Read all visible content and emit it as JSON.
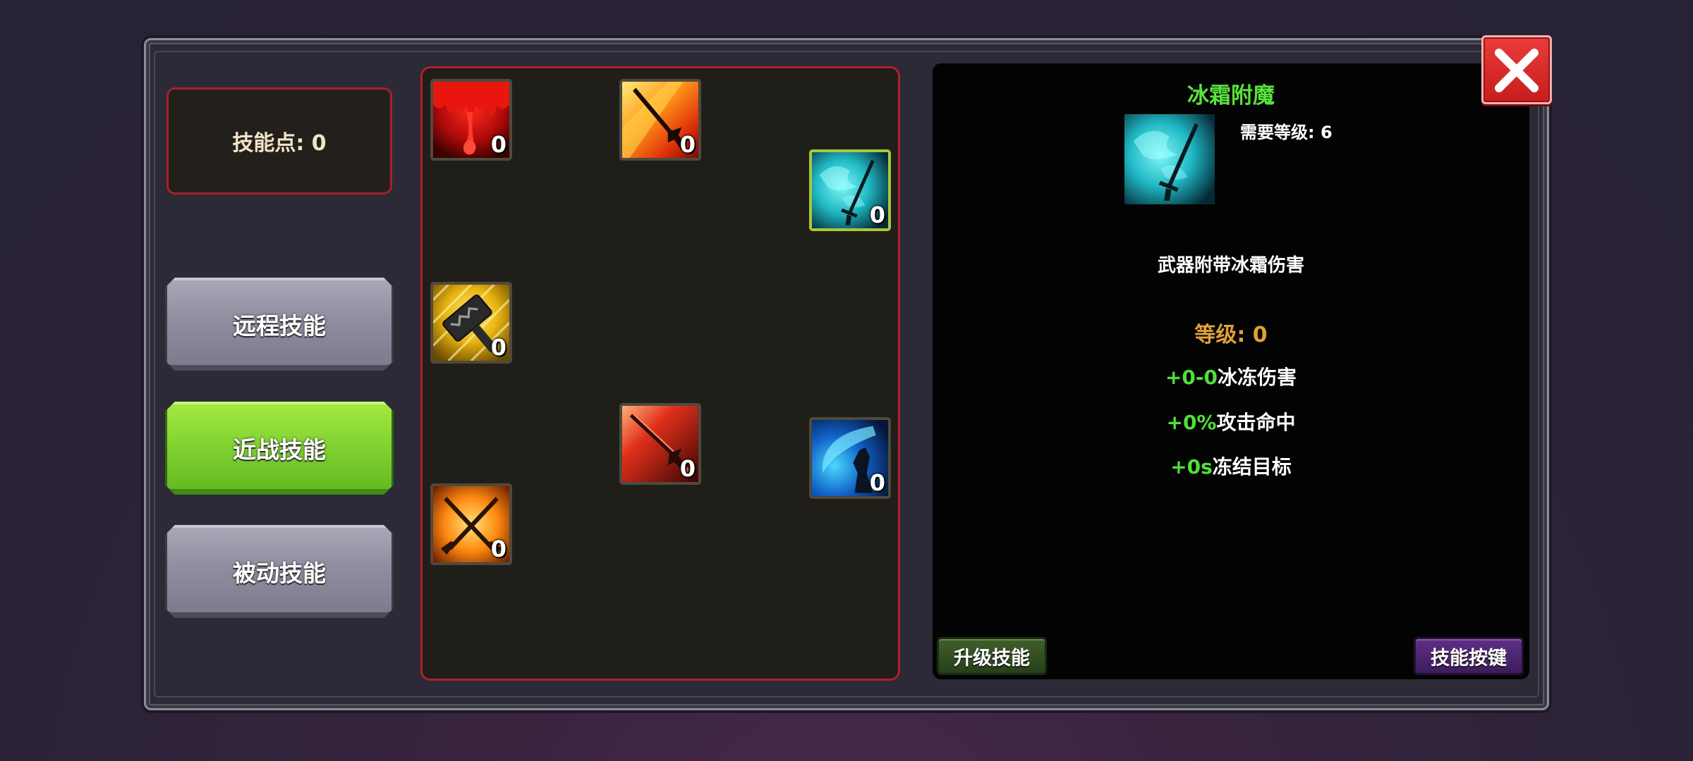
{
  "sidebar": {
    "skill_points_label": "技能点: 0",
    "categories": [
      {
        "label": "远程技能",
        "active": false
      },
      {
        "label": "近战技能",
        "active": true
      },
      {
        "label": "被动技能",
        "active": false
      }
    ]
  },
  "skill_tree": {
    "skills": [
      {
        "icon": "blood-drip-icon",
        "level": "0"
      },
      {
        "icon": "flaming-sword-icon",
        "level": "0"
      },
      {
        "icon": "frost-sword-icon",
        "level": "0",
        "selected": true
      },
      {
        "icon": "golden-hammer-icon",
        "level": "0"
      },
      {
        "icon": "red-blade-icon",
        "level": "0"
      },
      {
        "icon": "blue-slash-icon",
        "level": "0"
      },
      {
        "icon": "crossed-swords-icon",
        "level": "0"
      }
    ]
  },
  "detail": {
    "title": "冰霜附魔",
    "icon": "frost-sword-icon",
    "required_level": "需要等级: 6",
    "description": "武器附带冰霜伤害",
    "level": "等级: 0",
    "stats": [
      {
        "value": "+0-0",
        "label": "冰冻伤害"
      },
      {
        "value": "+0%",
        "label": "攻击命中"
      },
      {
        "value": "+0s",
        "label": "冻结目标"
      }
    ],
    "upgrade_label": "升级技能",
    "keybind_label": "技能按键"
  },
  "colors": {
    "accent_green": "#5ae33b",
    "frame_red": "#b01f2b",
    "level_orange": "#e0a13a",
    "close_red": "#d82828"
  }
}
